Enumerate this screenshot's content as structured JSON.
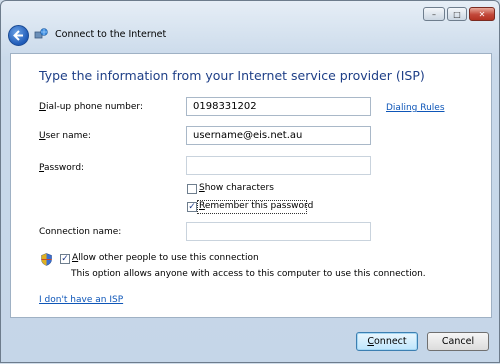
{
  "window": {
    "title": "Connect to the Internet",
    "controls": {
      "minimize": "–",
      "maximize": "□",
      "close": "✕"
    }
  },
  "main": {
    "heading": "Type the information from your Internet service provider (ISP)",
    "fields": {
      "dialup": {
        "label_prefix": "D",
        "label_rest": "ial-up phone number:",
        "value": "0198331202"
      },
      "username": {
        "label_prefix": "U",
        "label_rest": "ser name:",
        "value": "username@eis.net.au"
      },
      "password": {
        "label_prefix": "P",
        "label_rest": "assword:",
        "value": ""
      },
      "connection_name": {
        "label": "Connection name:",
        "value": ""
      }
    },
    "dialing_rules_link": "Dialing Rules",
    "show_characters": {
      "label_prefix": "S",
      "label_rest": "how characters",
      "checked": false
    },
    "remember_password": {
      "label_prefix": "R",
      "label_rest": "emember this password",
      "checked": true
    },
    "allow_others": {
      "label_prefix": "A",
      "label_rest": "llow other people to use this connection",
      "checked": true
    },
    "allow_note": "This option allows anyone with access to this computer to use this connection.",
    "no_isp_link": "I don't have an ISP"
  },
  "footer": {
    "connect_label_prefix": "C",
    "connect_label_rest": "onnect",
    "cancel_label": "Cancel"
  },
  "colors": {
    "heading": "#1e3f87",
    "link": "#0e56b8",
    "chrome": "#c9d9ea"
  },
  "icons": [
    "back-arrow-icon",
    "network-connection-icon",
    "uac-shield-icon",
    "checkmark-icon"
  ]
}
